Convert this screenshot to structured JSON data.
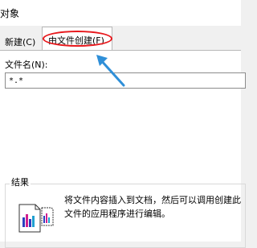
{
  "window": {
    "title": "对象"
  },
  "tabs": [
    {
      "label": "新建(C)"
    },
    {
      "label": "由文件创建(F)"
    }
  ],
  "file_tab": {
    "filename_label": "文件名(N):",
    "filename_value": "*.*"
  },
  "result": {
    "label": "结果",
    "line1": "将文件内容插入到文档，然后可以调用创建此",
    "line2": "文件的应用程序进行编辑。"
  },
  "annotation": {
    "color": "#e8181c",
    "arrow_color": "#2f8fd8"
  }
}
